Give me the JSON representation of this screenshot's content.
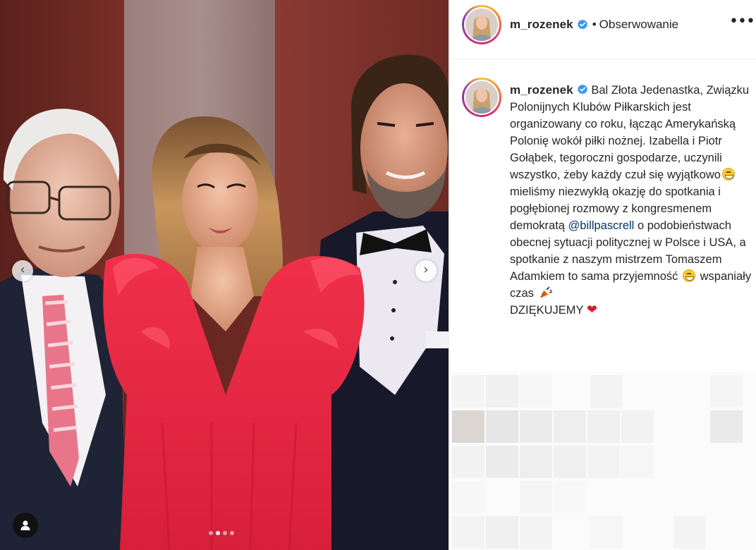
{
  "post": {
    "username": "m_rozenek",
    "follow_separator": "•",
    "follow_status": "Obserwowanie",
    "more_icon": "•••",
    "nav_prev_icon": "‹",
    "nav_next_icon": "›",
    "carousel": {
      "total": 4,
      "active": 2
    }
  },
  "caption": {
    "username": "m_rozenek",
    "text_1": "Bal Złota Jedenastka, Związku Polonijnych Klubów Piłkarskich jest organizowany co roku, łącząc Amerykańską Polonię wokół piłki nożnej. Izabella i Piotr Gołąbek, tegoroczni gospodarze, uczynili wszystko, żeby każdy czuł się wyjątkowo",
    "text_2": "mieliśmy niezwykłą okazję do spotkania i pogłębionej rozmowy z kongresmenem demokratą",
    "mention": "@billpascrell",
    "text_3": "o podobieństwach obecnej sytuacji politycznej w Polsce i USA, a spotkanie z naszym mistrzem Tomaszem Adamkiem to sama przyjemność",
    "text_4": "wspaniały czas",
    "text_5": "DZIĘKUJEMY",
    "heart": "❤"
  },
  "colors": {
    "verified": "#3897f0",
    "dress": "#e8243f",
    "mention": "#00376b"
  },
  "icons": [
    "verified-badge-icon",
    "more-options-icon",
    "chevron-left-icon",
    "chevron-right-icon",
    "user-tag-icon",
    "grinning-emoji-icon",
    "party-popper-emoji-icon",
    "red-heart-emoji-icon"
  ]
}
